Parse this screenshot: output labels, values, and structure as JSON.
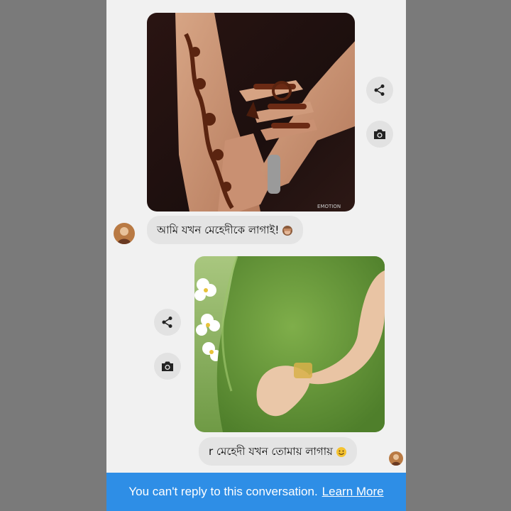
{
  "colors": {
    "chat_background": "#f1f1f1",
    "bubble_background": "#e4e4e4",
    "banner_background": "#2e8ee6",
    "banner_text": "#ffffff",
    "side_bands": "#7a7a7a"
  },
  "messages": [
    {
      "direction": "incoming",
      "image": "henna-hands-photo",
      "watermark": "EMOTION",
      "text": "আমি যখন মেহেদীকে লাগাই!",
      "emoji": "see-no-evil-monkey"
    },
    {
      "direction": "outgoing",
      "image": "pregnant-belly-green-dress-photo",
      "text": "r মেহেদী যখন তোমায় লাগায়",
      "emoji": "smiling-face"
    }
  ],
  "actions": {
    "share_icon": "share-icon",
    "camera_icon": "camera-icon"
  },
  "banner": {
    "text": "You can't reply to this conversation.",
    "link": "Learn More"
  }
}
